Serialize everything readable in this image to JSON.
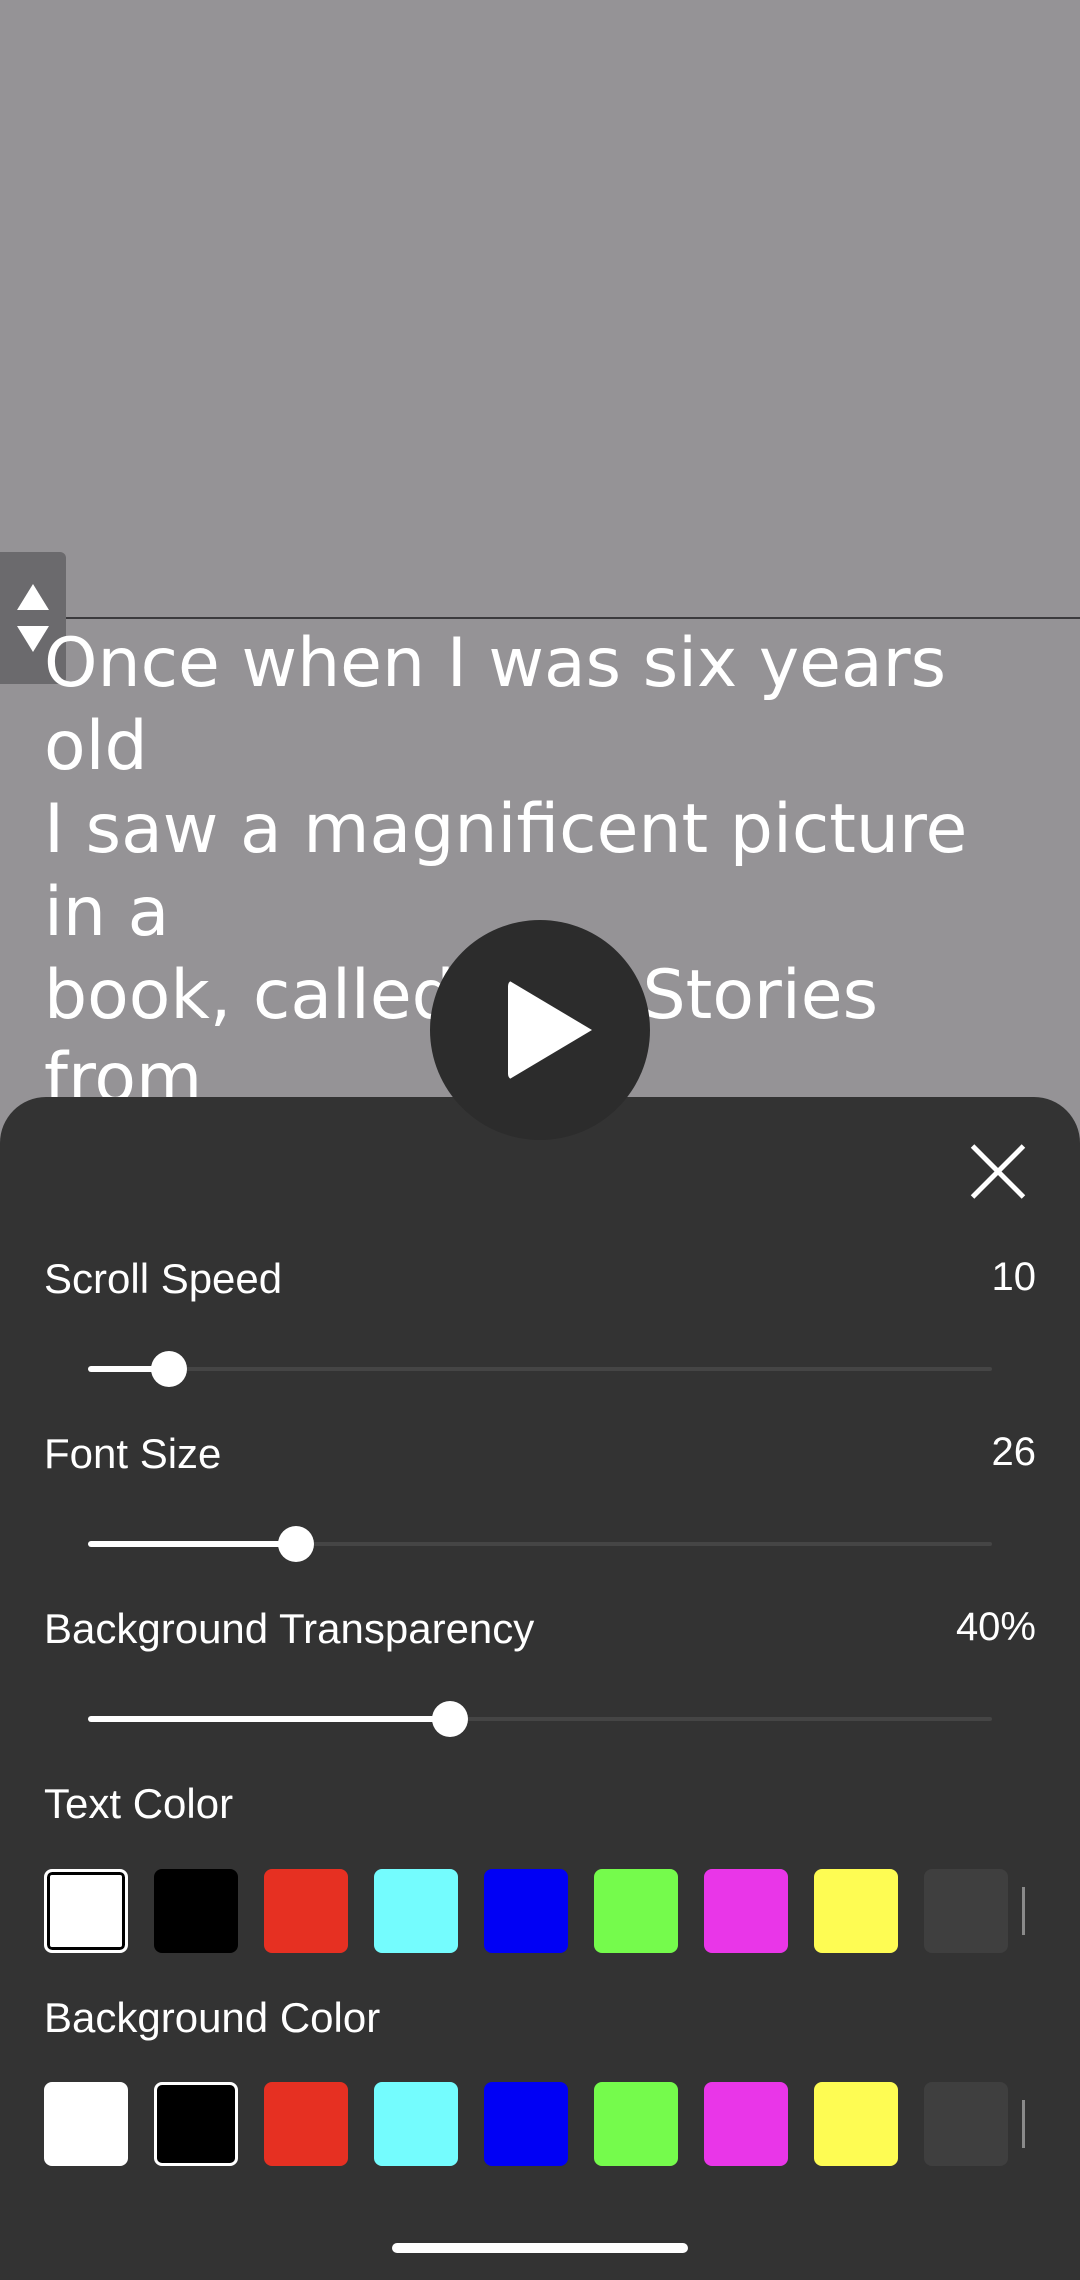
{
  "prompter": {
    "text": "Once when I was six years old\nI saw a magnificent picture in a\nbook, called True Stories from\nNature, about the primeval\nforest. It was a picture of a\nboa constrictor in the act of",
    "text_color": "#ffffff",
    "background_color": "#959396"
  },
  "settings": {
    "scroll_speed": {
      "label": "Scroll Speed",
      "value": "10",
      "fraction": 0.09
    },
    "font_size": {
      "label": "Font Size",
      "value": "26",
      "fraction": 0.23
    },
    "background_transparency": {
      "label": "Background Transparency",
      "value": "40%",
      "fraction": 0.4
    },
    "text_color": {
      "label": "Text Color",
      "selected_index": 0,
      "swatches": [
        "#ffffff",
        "#000000",
        "#e63022",
        "#74fcfe",
        "#0000f5",
        "#75fb4c",
        "#e936e8",
        "#fefc53",
        "#3f3f3f"
      ]
    },
    "background_color": {
      "label": "Background Color",
      "selected_index": 1,
      "swatches": [
        "#ffffff",
        "#000000",
        "#e63022",
        "#74fcfe",
        "#0000f5",
        "#75fb4c",
        "#e936e8",
        "#fefc53",
        "#3f3f3f"
      ]
    }
  },
  "icons": {
    "handle": [
      "arrow-up-icon",
      "arrow-down-icon"
    ],
    "play": "play-icon",
    "close": "close-icon"
  },
  "colors": {
    "sheet_bg": "#333333",
    "accent": "#ffffff"
  }
}
